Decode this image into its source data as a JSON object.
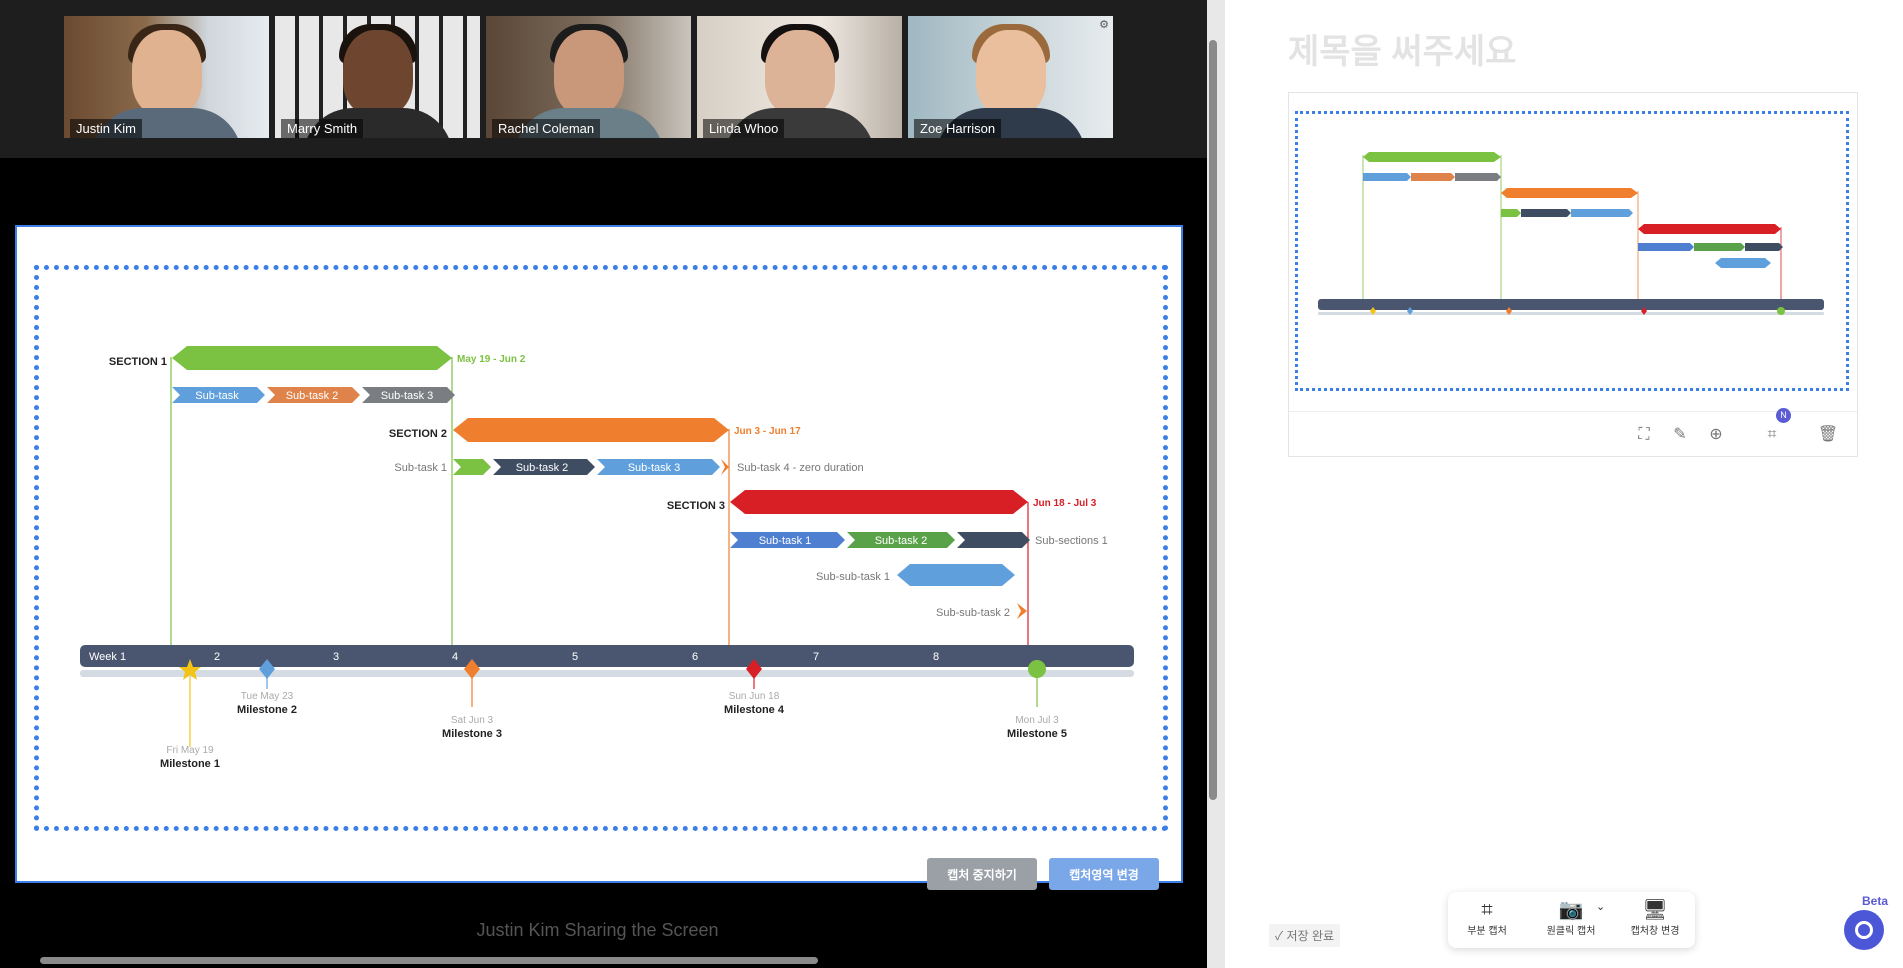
{
  "participants": [
    {
      "name": "Justin Kim",
      "active": true
    },
    {
      "name": "Marry Smith",
      "active": false
    },
    {
      "name": "Rachel Coleman",
      "active": false
    },
    {
      "name": "Linda Whoo",
      "active": false
    },
    {
      "name": "Zoe Harrison",
      "active": false
    }
  ],
  "share_controls": {
    "stop_label": "캡처 중지하기",
    "change_label": "캡처영역 변경"
  },
  "sharing_caption": "Justin Kim Sharing the Screen",
  "gantt": {
    "weeks": [
      "Week 1",
      "2",
      "3",
      "4",
      "5",
      "6",
      "7",
      "8"
    ],
    "sections": [
      {
        "label": "SECTION 1",
        "range": "May 19 - Jun 2",
        "color": "#7cc242"
      },
      {
        "label": "SECTION 2",
        "range": "Jun 3 - Jun 17",
        "color": "#ef7e2e"
      },
      {
        "label": "SECTION 3",
        "range": "Jun 18 - Jul 3",
        "color": "#d81f26"
      }
    ],
    "s1_tasks": [
      "Sub-task",
      "Sub-task 2",
      "Sub-task 3"
    ],
    "s2_tasks": [
      "Sub-task 1",
      "Sub-task 2",
      "Sub-task 3",
      "Sub-task 4 - zero duration"
    ],
    "s3_tasks": [
      "Sub-task 1",
      "Sub-task 2",
      "Sub-sections 1"
    ],
    "subsub": [
      "Sub-sub-task 1",
      "Sub-sub-task 2"
    ],
    "milestones": [
      {
        "date": "Fri May 19",
        "label": "Milestone 1"
      },
      {
        "date": "Tue May 23",
        "label": "Milestone 2"
      },
      {
        "date": "Sat Jun 3",
        "label": "Milestone 3"
      },
      {
        "date": "Sun Jun 18",
        "label": "Milestone 4"
      },
      {
        "date": "Mon Jul 3",
        "label": "Milestone 5"
      }
    ]
  },
  "doc_title": "제목을 써주세요",
  "save_status": "저장 완료",
  "badge": "N",
  "bottom_bar": [
    {
      "label": "부분 캡처",
      "icon": "crop-icon"
    },
    {
      "label": "원클릭 캡처",
      "icon": "camera-icon"
    },
    {
      "label": "캡처창 변경",
      "icon": "monitor-icon"
    }
  ],
  "beta_label": "Beta"
}
